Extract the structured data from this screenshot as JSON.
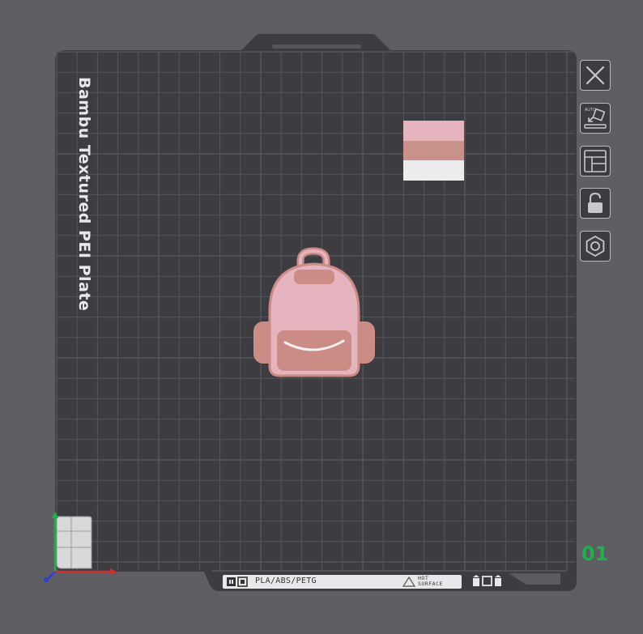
{
  "plate": {
    "name": "Bambu Textured PEI Plate",
    "number": "01",
    "bed_strip": {
      "material": "PLA/ABS/PETG",
      "hot_line1": "HOT",
      "hot_line2": "SURFACE"
    }
  },
  "objects": [
    {
      "name": "backpack",
      "color_main": "#e6b4bf",
      "color_accent": "#cc8c86"
    },
    {
      "name": "color-swatch",
      "colors": [
        "#e6b4bf",
        "#c8928a",
        "#ececee"
      ]
    }
  ],
  "toolbar": {
    "icons": [
      "close-icon",
      "auto-orient-icon",
      "arrange-icon",
      "lock-icon",
      "settings-icon"
    ]
  },
  "colors": {
    "background": "#5f5f63",
    "plate": "#3c3c41",
    "grid": "#55555a",
    "accent": "#1fb24a"
  }
}
